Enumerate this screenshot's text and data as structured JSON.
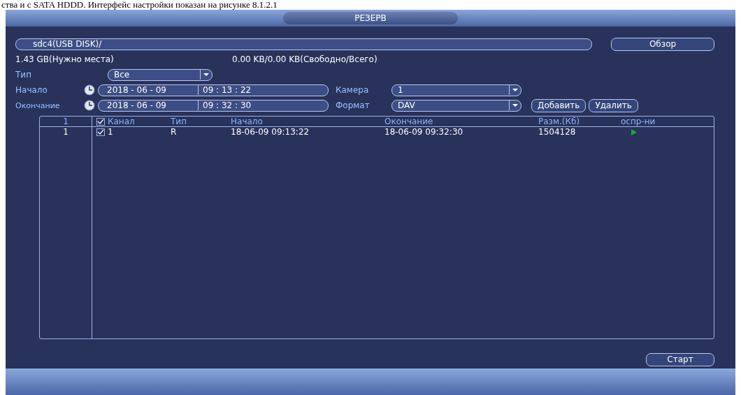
{
  "caption": "ства и с SATA HDDD.  Интерфейс настройки показан на рисунке 8.1.2.1",
  "window": {
    "title": "РЕЗЕРВ"
  },
  "device": {
    "path": "sdc4(USB DISK)/",
    "browse_button": "Обзор"
  },
  "space": {
    "needed": "1.43 GB(Нужно места)",
    "free_total": "0.00 KB/0.00 KB(Свободно/Всего)"
  },
  "form": {
    "type": {
      "label": "Тип",
      "value": "Все"
    },
    "start": {
      "label": "Начало",
      "date": "2018 - 06 - 09",
      "time": "09 : 13 : 22"
    },
    "end": {
      "label": "Окончание",
      "date": "2018 - 06 - 09",
      "time": "09 : 32 : 30"
    },
    "camera": {
      "label": "Камера",
      "value": "1"
    },
    "format": {
      "label": "Формат",
      "value": "DAV"
    }
  },
  "buttons": [
    {
      "label": "Добавить"
    },
    {
      "label": "Удалить"
    }
  ],
  "table": {
    "columns": [
      "1",
      "Канал",
      "Тип",
      "Начало",
      "Окончание",
      "Разм.(Кб)",
      "оспр-ни"
    ],
    "header_checked": true,
    "rows": [
      {
        "index": "1",
        "checked": true,
        "channel": "1",
        "type": "R",
        "start": "18-06-09 09:13:22",
        "end": "18-06-09 09:32:30",
        "size": "1504128",
        "playable": true
      }
    ]
  },
  "start_button": "Старт"
}
